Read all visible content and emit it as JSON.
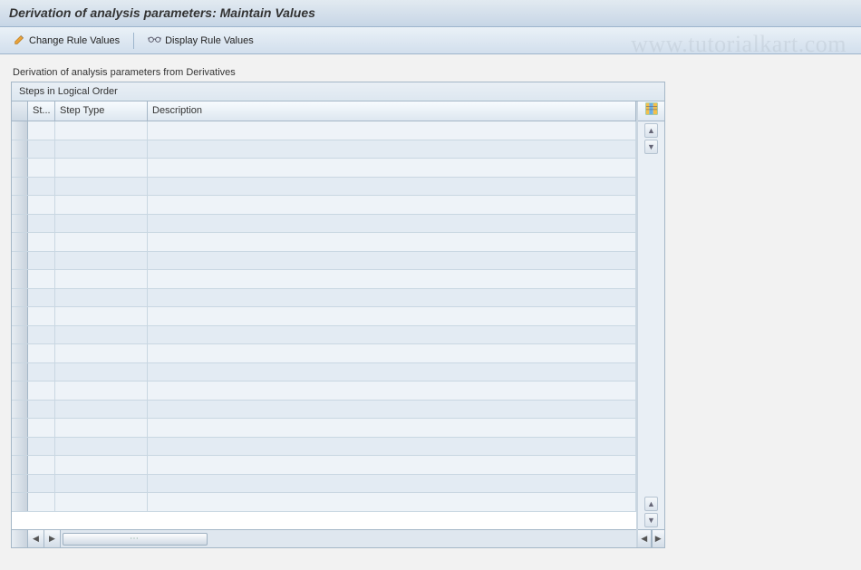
{
  "title": "Derivation of analysis parameters: Maintain Values",
  "toolbar": {
    "change_label": "Change Rule Values",
    "display_label": "Display Rule Values"
  },
  "subtitle": "Derivation of analysis parameters from Derivatives",
  "panel": {
    "header": "Steps in Logical Order",
    "columns": {
      "status": "St...",
      "step_type": "Step Type",
      "description": "Description"
    },
    "rows": [
      {
        "status": "",
        "step_type": "",
        "description": ""
      },
      {
        "status": "",
        "step_type": "",
        "description": ""
      },
      {
        "status": "",
        "step_type": "",
        "description": ""
      },
      {
        "status": "",
        "step_type": "",
        "description": ""
      },
      {
        "status": "",
        "step_type": "",
        "description": ""
      },
      {
        "status": "",
        "step_type": "",
        "description": ""
      },
      {
        "status": "",
        "step_type": "",
        "description": ""
      },
      {
        "status": "",
        "step_type": "",
        "description": ""
      },
      {
        "status": "",
        "step_type": "",
        "description": ""
      },
      {
        "status": "",
        "step_type": "",
        "description": ""
      },
      {
        "status": "",
        "step_type": "",
        "description": ""
      },
      {
        "status": "",
        "step_type": "",
        "description": ""
      },
      {
        "status": "",
        "step_type": "",
        "description": ""
      },
      {
        "status": "",
        "step_type": "",
        "description": ""
      },
      {
        "status": "",
        "step_type": "",
        "description": ""
      },
      {
        "status": "",
        "step_type": "",
        "description": ""
      },
      {
        "status": "",
        "step_type": "",
        "description": ""
      },
      {
        "status": "",
        "step_type": "",
        "description": ""
      },
      {
        "status": "",
        "step_type": "",
        "description": ""
      },
      {
        "status": "",
        "step_type": "",
        "description": ""
      },
      {
        "status": "",
        "step_type": "",
        "description": ""
      }
    ]
  },
  "watermark": "www.tutorialkart.com",
  "icons": {
    "pencil": "pencil-icon",
    "glasses": "glasses-icon",
    "table_settings": "table-settings-icon"
  }
}
